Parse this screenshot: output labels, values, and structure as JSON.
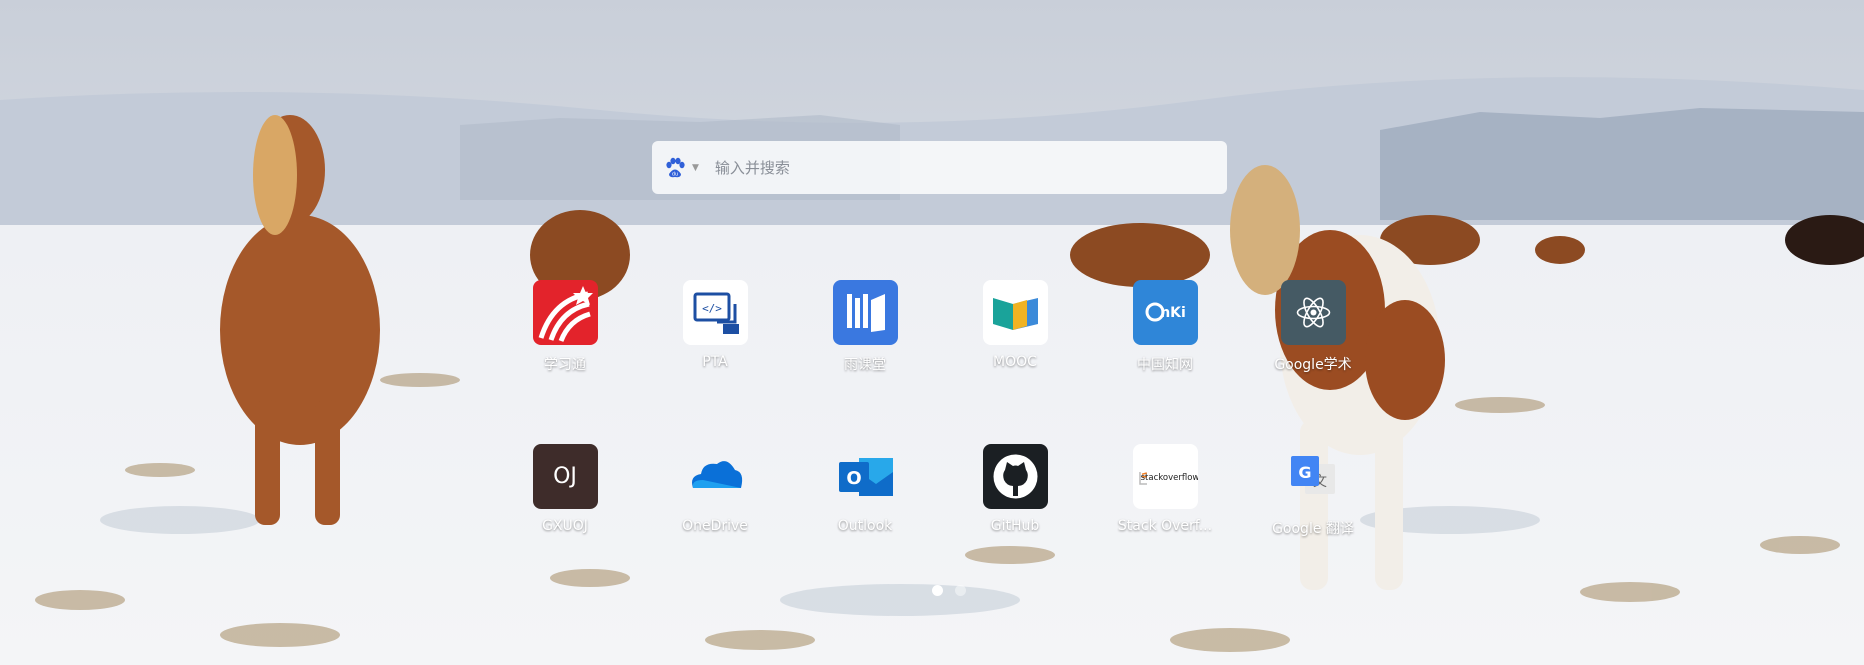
{
  "search": {
    "engine_icon": "baidu-paw-icon",
    "placeholder": "输入并搜索"
  },
  "shortcuts": [
    {
      "label": "学习通",
      "icon": "xuexitong-icon",
      "color": "#e3232b"
    },
    {
      "label": "PTA",
      "icon": "pta-code-icon",
      "color": "#ffffff"
    },
    {
      "label": "雨课堂",
      "icon": "yuketang-icon",
      "color": "#3a78e0"
    },
    {
      "label": "MOOC",
      "icon": "mooc-icon",
      "color": "#ffffff"
    },
    {
      "label": "中国知网",
      "icon": "cnki-icon",
      "color": "#2f86d8"
    },
    {
      "label": "Google学术",
      "icon": "atom-icon",
      "color": "#455a64"
    },
    {
      "label": "GXUOJ",
      "icon": "oj-icon",
      "icon_text": "OJ",
      "color": "#3e2c2a"
    },
    {
      "label": "OneDrive",
      "icon": "cloud-icon",
      "color": "#0a70d8"
    },
    {
      "label": "Outlook",
      "icon": "outlook-icon",
      "icon_text": "O",
      "color": "#0f6cc9"
    },
    {
      "label": "GitHub",
      "icon": "github-icon",
      "color": "#1b1f23"
    },
    {
      "label": "Stack Overf...",
      "icon": "stackoverflow-icon",
      "icon_text": "stackoverflow",
      "color": "#ffffff"
    },
    {
      "label": "Google 翻译",
      "icon": "google-translate-icon",
      "icon_text": "G",
      "color": "#4285f4"
    }
  ],
  "pagination": {
    "pages": 2,
    "current": 1
  }
}
